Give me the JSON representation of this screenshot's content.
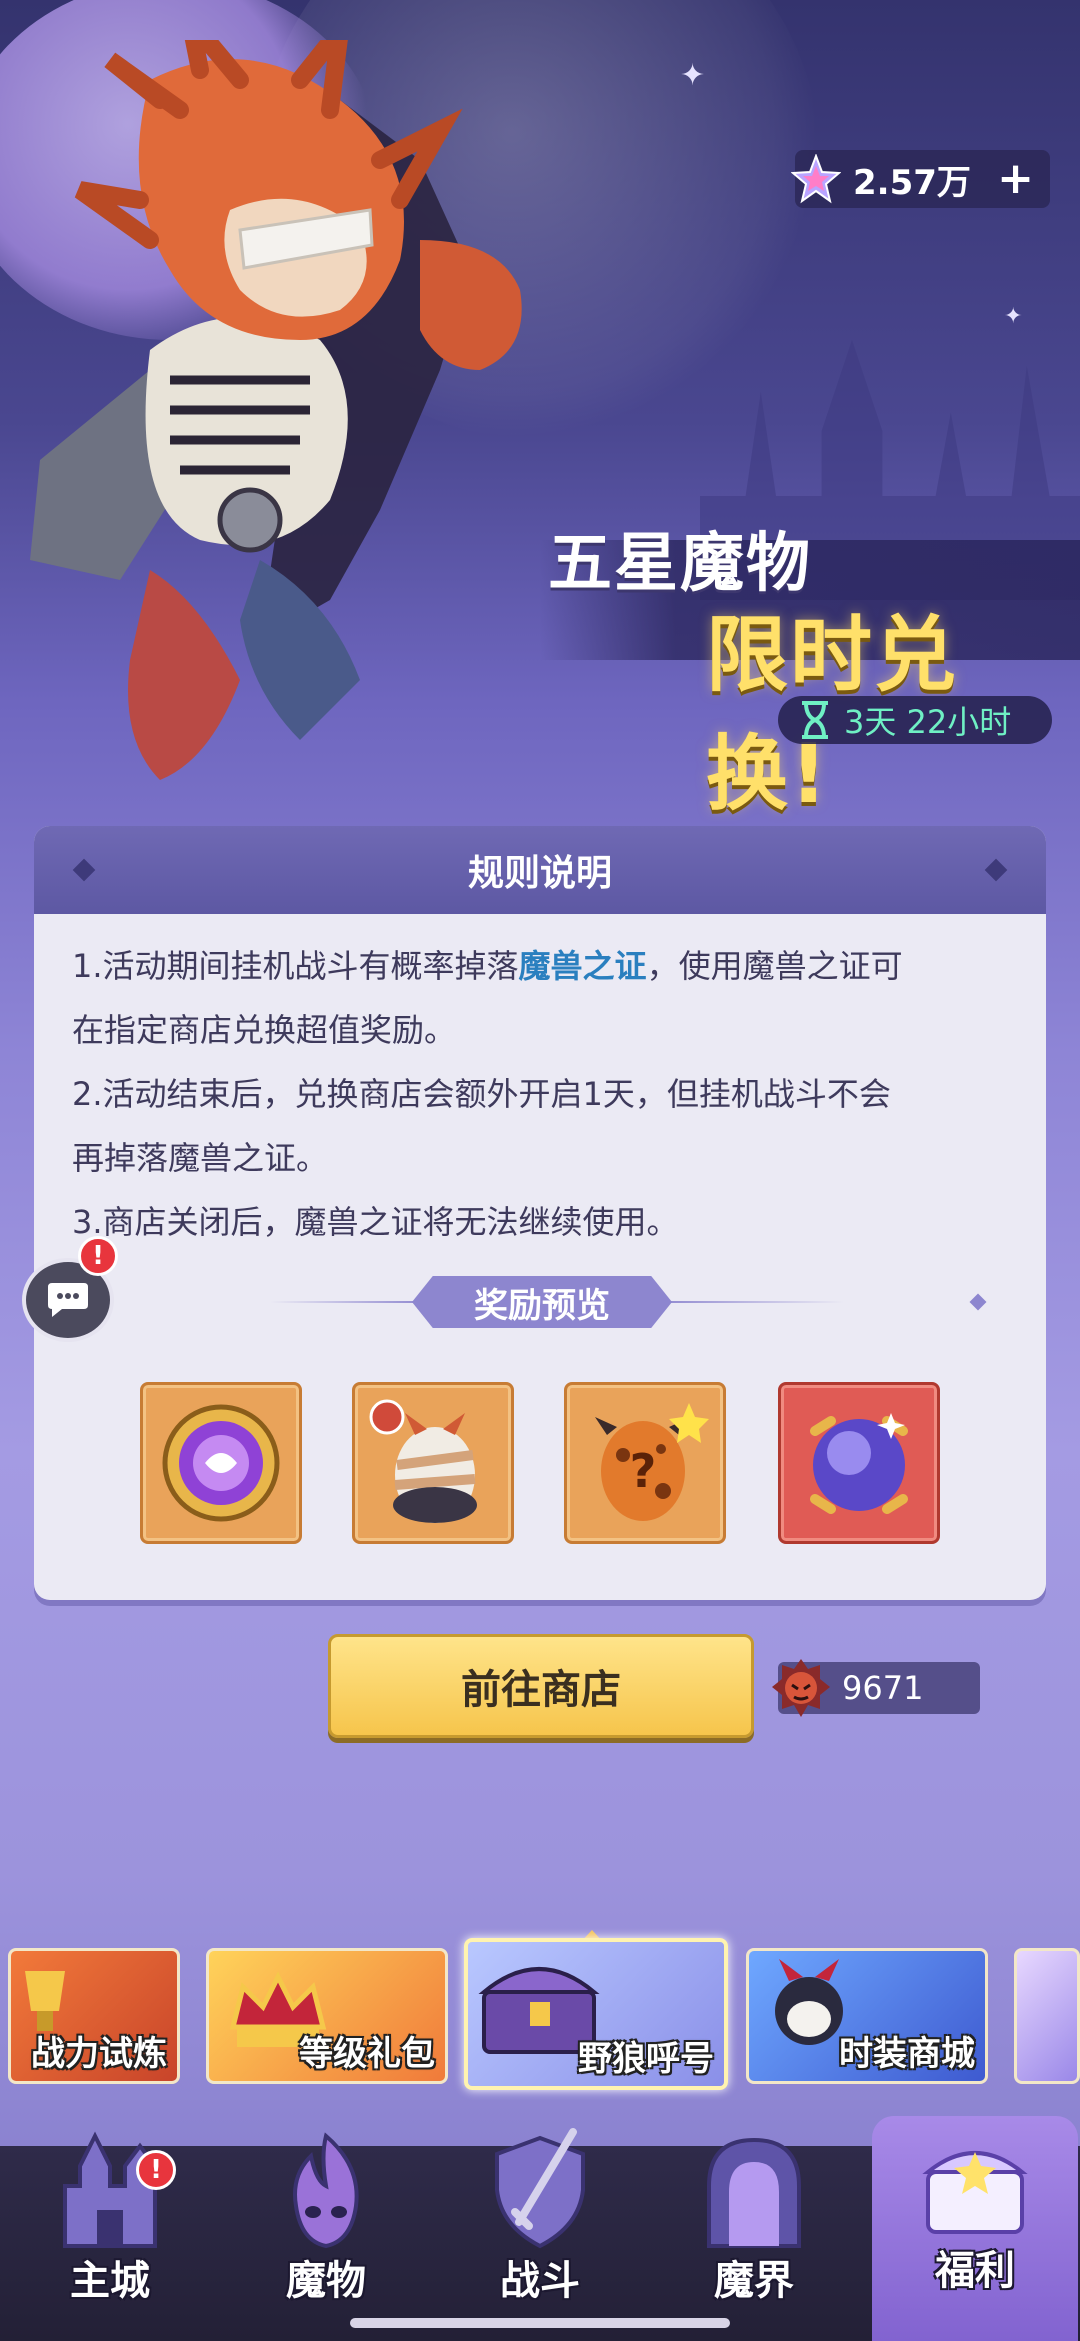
{
  "currency": {
    "amount": "2.57万",
    "plus": "+"
  },
  "event": {
    "title_line1": "五星魔物",
    "title_line2": "限时兑换!",
    "time_left": "3天 22小时"
  },
  "rules": {
    "header": "规则说明",
    "line1_pre": "1.活动期间挂机战斗有概率掉落",
    "line1_highlight": "魔兽之证",
    "line1_post": "，使用魔兽之证可",
    "line2": "在指定商店兑换超值奖励。",
    "line3": "2.活动结束后，兑换商店会额外开启1天，但挂机战斗不会",
    "line4": "再掉落魔兽之证。",
    "line5": "3.商店关闭后，魔兽之证将无法继续使用。",
    "preview_label": "奖励预览"
  },
  "shop": {
    "button": "前往商店",
    "token_count": "9671"
  },
  "events_carousel": [
    {
      "label": "战力试炼"
    },
    {
      "label": "等级礼包"
    },
    {
      "label": "野狼呼号"
    },
    {
      "label": "时装商城"
    }
  ],
  "nav": [
    {
      "label": "主城"
    },
    {
      "label": "魔物"
    },
    {
      "label": "战斗"
    },
    {
      "label": "魔界"
    },
    {
      "label": "福利"
    }
  ],
  "badges": {
    "alert": "!"
  }
}
